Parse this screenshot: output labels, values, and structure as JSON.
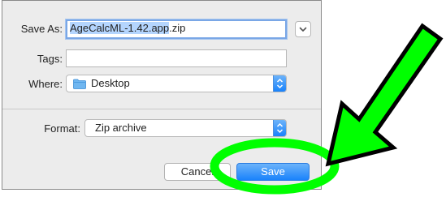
{
  "dialog": {
    "save_as_label": "Save As:",
    "filename_selected": "AgeCalcML-1.42.app",
    "filename_ext": ".zip",
    "tags_label": "Tags:",
    "tags_value": "",
    "where_label": "Where:",
    "where_value": "Desktop",
    "format_label": "Format:",
    "format_value": "Zip archive",
    "cancel_label": "Cancel",
    "save_label": "Save"
  },
  "annotation": {
    "arrow_color": "#00ff00",
    "arrow_outline": "#000000",
    "highlight_color": "#00ff00"
  },
  "colors": {
    "accent_blue": "#1a82fb",
    "folder_blue": "#6fb6f0",
    "selection": "#b4d5fe"
  }
}
